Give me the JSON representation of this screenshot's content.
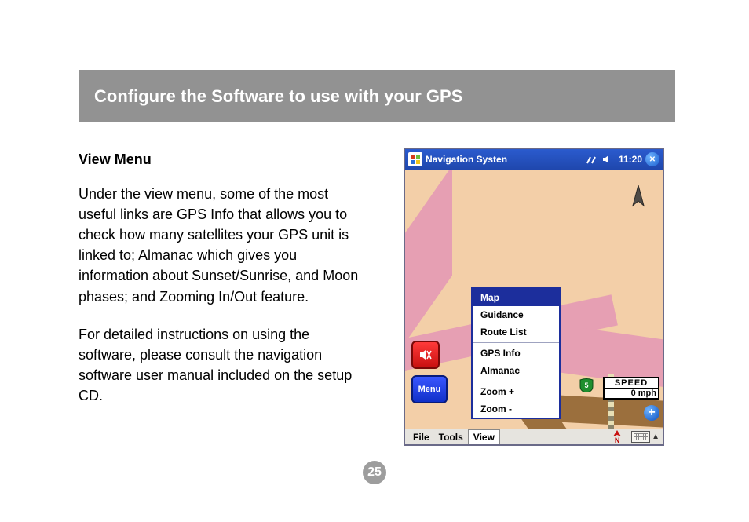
{
  "header": {
    "title": "Configure the Software to use with your GPS"
  },
  "text": {
    "subhead": "View Menu",
    "para1": "Under the view menu, some of the most useful links are GPS Info that allows you to check how many satellites your GPS unit is linked to; Almanac which gives you information about Sunset/Sunrise, and Moon phases; and Zooming In/Out feature.",
    "para2": "For detailed instructions on using the software, please consult the navigation software user manual included on the setup CD."
  },
  "page_number": "25",
  "device": {
    "titlebar": {
      "app_name": "Navigation Systen",
      "time": "11:20"
    },
    "view_menu": {
      "items": [
        "Map",
        "Guidance",
        "Route List",
        "GPS Info",
        "Almanac",
        "Zoom +",
        "Zoom -"
      ],
      "selected": "Map"
    },
    "buttons": {
      "menu_label": "Menu"
    },
    "speed": {
      "label": "SPEED",
      "value": "0 mph"
    },
    "bottombar": {
      "items": [
        "File",
        "Tools",
        "View"
      ],
      "selected": "View",
      "compass_dir": "N"
    }
  }
}
